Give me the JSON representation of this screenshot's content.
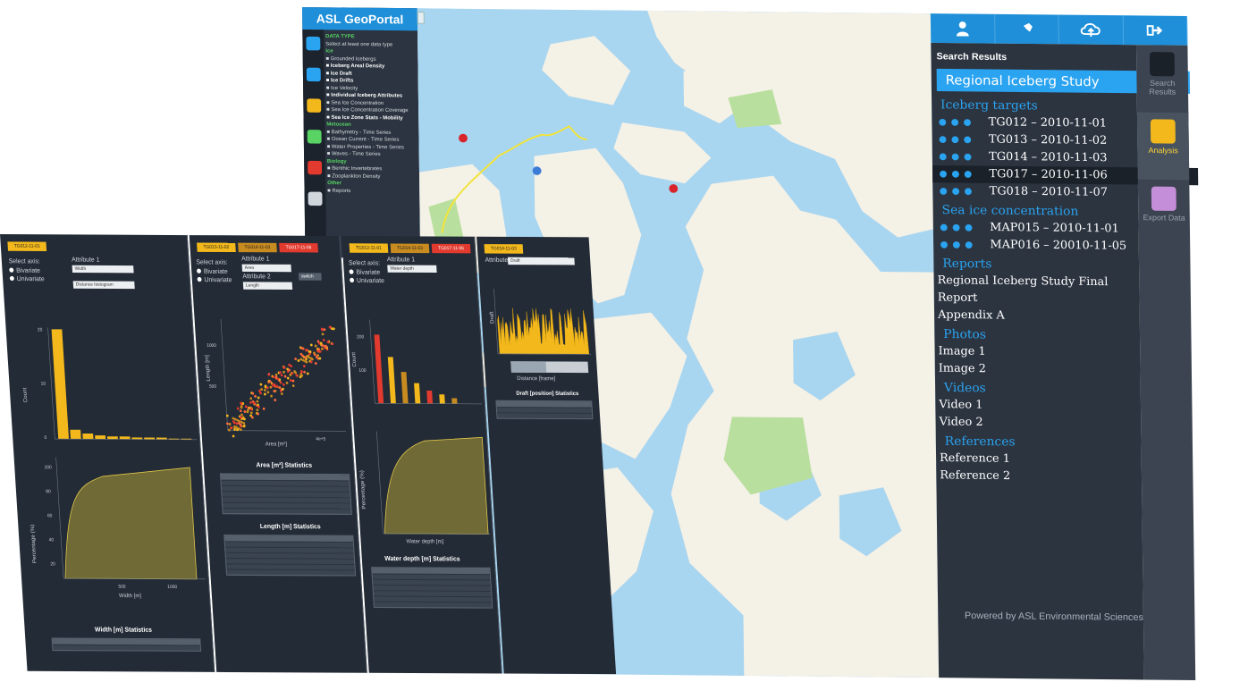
{
  "geoportal": {
    "brand": "ASL GeoPortal",
    "data_type_heading": "DATA TYPE",
    "data_type_instruction": "Select at least one data type",
    "data_types": [
      {
        "label": "Ice",
        "kind": "heading"
      },
      {
        "label": "Grounded Icebergs",
        "kind": "item"
      },
      {
        "label": "Iceberg Areal Density",
        "kind": "selected"
      },
      {
        "label": "Ice Draft",
        "kind": "selected"
      },
      {
        "label": "Ice Drifts",
        "kind": "selected"
      },
      {
        "label": "Ice Velocity",
        "kind": "item"
      },
      {
        "label": "Individual Iceberg Attributes",
        "kind": "selected"
      },
      {
        "label": "Sea Ice Concentration",
        "kind": "item"
      },
      {
        "label": "Sea Ice Concentration Coverage",
        "kind": "item"
      },
      {
        "label": "Sea Ice Zone Stats - Mobility",
        "kind": "selected"
      },
      {
        "label": "Metocean",
        "kind": "heading"
      },
      {
        "label": "Bathymetry - Time Series",
        "kind": "item"
      },
      {
        "label": "Ocean Current - Time Series",
        "kind": "item"
      },
      {
        "label": "Water Properties - Time Series",
        "kind": "item"
      },
      {
        "label": "Waves - Time Series",
        "kind": "item"
      },
      {
        "label": "Biology",
        "kind": "heading"
      },
      {
        "label": "Benthic Invertebrates",
        "kind": "item"
      },
      {
        "label": "Zooplankton Density",
        "kind": "item"
      },
      {
        "label": "Other",
        "kind": "heading"
      },
      {
        "label": "Reports",
        "kind": "item"
      }
    ],
    "rail_icons": [
      "search-icon",
      "asl-logo-icon",
      "explore-icon",
      "time-icon",
      "institution-icon",
      "collapse-icon"
    ],
    "powered_by": "Powered by ASL Environmental Sciences"
  },
  "top_buttons": [
    "user-icon",
    "pin-icon",
    "upload-cloud-icon",
    "logout-icon"
  ],
  "right_rail": [
    {
      "label": "Search Results",
      "icon": "document-icon",
      "active": false
    },
    {
      "label": "Analysis",
      "icon": "bar-chart-icon",
      "active": true
    },
    {
      "label": "Export Data",
      "icon": "cloud-download-icon",
      "active": false
    }
  ],
  "search_results": {
    "title": "Search Results",
    "study": "Regional Iceberg Study",
    "iceberg_heading": "Iceberg targets",
    "iceberg_targets": [
      {
        "label": "TG012 – 2010-11-01",
        "highlighted": false
      },
      {
        "label": "TG013 – 2010-11-02",
        "highlighted": false
      },
      {
        "label": "TG014 – 2010-11-03",
        "highlighted": false
      },
      {
        "label": "TG017 – 2010-11-06",
        "highlighted": true
      },
      {
        "label": "TG018 – 2010-11-07",
        "highlighted": false
      }
    ],
    "sea_ice_heading": "Sea ice concentration",
    "sea_ice": [
      "MAP015 – 2010-11-01",
      "MAP016 – 20010-11-05"
    ],
    "reports_heading": "Reports",
    "reports": [
      "Regional Iceberg Study Final",
      "Report",
      "Appendix A"
    ],
    "photos_heading": "Photos",
    "photos": [
      "Image 1",
      "Image 2"
    ],
    "videos_heading": "Videos",
    "videos": [
      "Video 1",
      "Video 2"
    ],
    "references_heading": "References",
    "references": [
      "Reference 1",
      "Reference 2"
    ]
  },
  "analysis": {
    "panel1": {
      "tab": "TG012-11-01",
      "select_axis_label": "Select axis:",
      "radio_bivariate": "Bivariate",
      "radio_univariate": "Univariate",
      "attribute_label": "Attribute 1",
      "attribute_value": "Width",
      "button": "Distance histogram",
      "ylabel_count": "Count",
      "ylabel_pct": "Percentage (%)",
      "xlabel": "Width [m]",
      "stats_title": "Width [m] Statistics",
      "yticks": [
        "20",
        "10",
        "0"
      ],
      "pct_ticks": [
        "100",
        "80",
        "60",
        "40",
        "20"
      ],
      "xticks": [
        "500",
        "1000"
      ]
    },
    "panel2": {
      "tabs": [
        "TG013-11-02",
        "TG014-11-03",
        "TG017-11-06"
      ],
      "select_axis_label": "Select axis:",
      "radio_bivariate": "Bivariate",
      "radio_univariate": "Univariate",
      "attribute1_label": "Attribute 1",
      "attribute1_value": "Area",
      "attribute2_label": "Attribute 2",
      "attribute2_value": "Length",
      "switch_button": "switch",
      "ylabel": "Length [m]",
      "xlabel": "Area [m²]",
      "yticks": [
        "1000",
        "500"
      ],
      "xticks": [
        "4e+5"
      ],
      "stats_title_1": "Area [m²] Statistics",
      "stats_title_2": "Length [m] Statistics"
    },
    "panel3": {
      "tabs": [
        "TG012-11-01",
        "TG014-11-03",
        "TG017-11-06"
      ],
      "select_axis_label": "Select axis:",
      "radio_bivariate": "Bivariate",
      "radio_univariate": "Univariate",
      "attribute_label": "Attribute 1",
      "attribute_value": "Water depth",
      "ylabel_count": "Count",
      "ylabel_pct": "Percentage (%)",
      "xlabel": "Water depth [m]",
      "stats_title": "Water depth [m] Statistics",
      "yticks": [
        "200",
        "100"
      ]
    },
    "panel4": {
      "tab": "TG014-11-03",
      "attribute_label": "Attribute",
      "attribute_value": "Draft",
      "ylabel": "Draft",
      "xlabel": "Distance [frame]",
      "stats_title": "Draft [position] Statistics"
    }
  },
  "colors": {
    "accent": "#1e8fd8",
    "panel_bg": "#232b36",
    "sidebar_bg": "#2c3440",
    "yellow": "#f2b81c",
    "map_water": "#a8d5f0",
    "map_land": "#f4f1e6",
    "map_park": "#b9df9e"
  }
}
